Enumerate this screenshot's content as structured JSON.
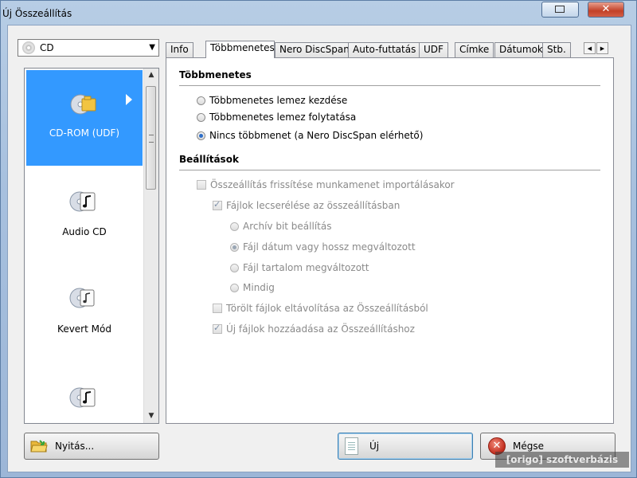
{
  "window": {
    "title": "Új Összeállítás"
  },
  "disc_selector": {
    "value": "CD"
  },
  "disc_types": [
    {
      "label": "CD-ROM (UDF)",
      "selected": true
    },
    {
      "label": "Audio CD",
      "selected": false
    },
    {
      "label": "Kevert Mód",
      "selected": false
    },
    {
      "label": "",
      "selected": false
    }
  ],
  "tabs": [
    "Info",
    "Többmenetes",
    "Nero DiscSpan",
    "Auto-futtatás",
    "UDF",
    "Címke",
    "Dátumok",
    "Stb."
  ],
  "active_tab": "Többmenetes",
  "multisession": {
    "title": "Többmenetes",
    "options": [
      "Többmenetes lemez kezdése",
      "Többmenetes lemez folytatása",
      "Nincs többmenet (a Nero DiscSpan elérhető)"
    ],
    "selected": 2
  },
  "settings": {
    "title": "Beállítások",
    "refresh_label": "Összeállítás frissítése munkamenet importálásakor",
    "replace_label": "Fájlok lecserélése az összeállításban",
    "radio_archive": "Archív bit beállítás",
    "radio_date": "Fájl dátum vagy hossz megváltozott",
    "radio_content": "Fájl tartalom megváltozott",
    "radio_always": "Mindig",
    "remove_label": "Törölt fájlok eltávolítása az Összeállításból",
    "add_label": "Új fájlok hozzáadása az Összeállításhoz"
  },
  "buttons": {
    "open": "Nyitás...",
    "new": "Új",
    "cancel": "Mégse"
  },
  "watermark": "[origo] szoftverbázis",
  "colors": {
    "selection": "#3399ff",
    "disabled_text": "#8a8a8a"
  }
}
